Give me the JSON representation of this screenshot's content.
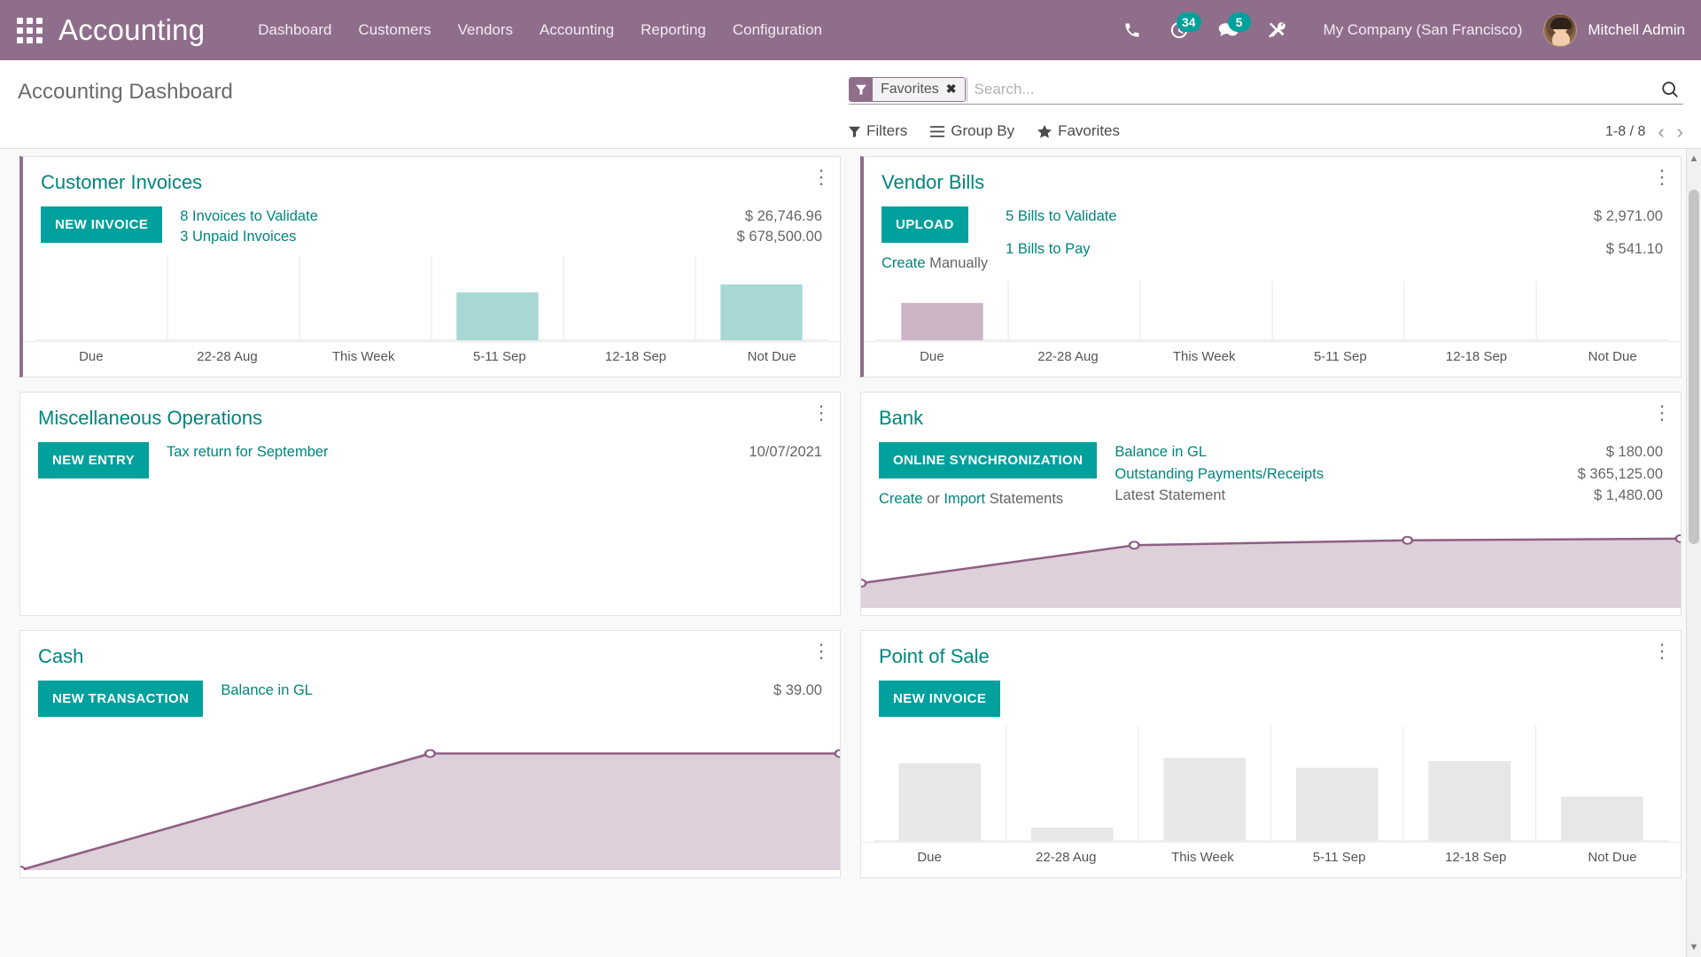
{
  "navbar": {
    "apps_icon": "apps-grid-icon",
    "brand": "Accounting",
    "menu": [
      {
        "label": "Dashboard"
      },
      {
        "label": "Customers"
      },
      {
        "label": "Vendors"
      },
      {
        "label": "Accounting"
      },
      {
        "label": "Reporting"
      },
      {
        "label": "Configuration"
      }
    ],
    "tray": {
      "phone_icon": "phone-icon",
      "activity_icon": "clock-activity-icon",
      "activity_count": "34",
      "messages_icon": "chat-bubble-icon",
      "messages_count": "5",
      "debug_icon": "tools-wrench-icon"
    },
    "company": "My Company (San Francisco)",
    "user": "Mitchell Admin",
    "avatar_icon": "user-avatar"
  },
  "control_panel": {
    "title": "Accounting Dashboard",
    "facet": {
      "icon": "filter-funnel-icon",
      "label": "Favorites",
      "remove": "✖"
    },
    "search": {
      "value": "",
      "placeholder": "Search..."
    },
    "search_icon": "search-magnifier-icon",
    "buttons": [
      {
        "label": "Filters",
        "icon": "filter-funnel-icon"
      },
      {
        "label": "Group By",
        "icon": "hamburger-lines-icon"
      },
      {
        "label": "Favorites",
        "icon": "star-icon"
      }
    ],
    "pager": {
      "range": "1-8 / 8",
      "prev": "‹",
      "next": "›"
    }
  },
  "accent": {
    "brand_purple": "#8f6e8b",
    "teal": "#00a09d",
    "teal_text": "#00857d",
    "bar_teal": "#a8d8d4",
    "bar_purple": "#cbb4c6",
    "bar_gray": "#e7e7e7",
    "line_purple": "#8f5f85",
    "area_purple": "#ddd0da"
  },
  "cards": [
    {
      "id": "customer-invoices",
      "title": "Customer Invoices",
      "button": "NEW INVOICE",
      "sub_links": [],
      "kpis": [
        {
          "label": "8 Invoices to Validate",
          "value": "$ 26,746.96",
          "link": true
        },
        {
          "label": "3 Unpaid Invoices",
          "value": "$ 678,500.00",
          "link": true
        }
      ],
      "chart_data": {
        "type": "bar",
        "title": "Customer Invoices",
        "categories": [
          "Due",
          "22-28 Aug",
          "This Week",
          "5-11 Sep",
          "12-18 Sep",
          "Not Due"
        ],
        "values": [
          0,
          0,
          0,
          60,
          0,
          70
        ],
        "ylim": [
          0,
          100
        ],
        "color": "#a8d8d4",
        "xlabel": "",
        "ylabel": "",
        "grid": true,
        "legend": "none"
      }
    },
    {
      "id": "vendor-bills",
      "title": "Vendor Bills",
      "button": "UPLOAD",
      "sub_links": [
        {
          "text": "Create",
          "link": true
        },
        {
          "text": " Manually",
          "link": false
        }
      ],
      "kpis": [
        {
          "label": "5 Bills to Validate",
          "value": "$ 2,971.00",
          "link": true
        },
        {
          "label": "1 Bills to Pay",
          "value": "$ 541.10",
          "link": true
        }
      ],
      "chart_data": {
        "type": "bar",
        "title": "Vendor Bills",
        "categories": [
          "Due",
          "22-28 Aug",
          "This Week",
          "5-11 Sep",
          "12-18 Sep",
          "Not Due"
        ],
        "values": [
          68,
          0,
          0,
          0,
          0,
          0
        ],
        "ylim": [
          0,
          100
        ],
        "color": "#cbb4c6",
        "xlabel": "",
        "ylabel": "",
        "grid": true,
        "legend": "none"
      }
    },
    {
      "id": "miscellaneous-operations",
      "title": "Miscellaneous Operations",
      "button": "NEW ENTRY",
      "sub_links": [],
      "kpis": [
        {
          "label": "Tax return for September",
          "value": "10/07/2021",
          "link": true
        }
      ],
      "chart_data": null
    },
    {
      "id": "bank",
      "title": "Bank",
      "button": "ONLINE SYNCHRONIZATION",
      "sub_links": [
        {
          "text": "Create",
          "link": true
        },
        {
          "text": " or ",
          "link": false
        },
        {
          "text": "Import",
          "link": true
        },
        {
          "text": " Statements",
          "link": false
        }
      ],
      "kpis": [
        {
          "label": "Balance in GL",
          "value": "$ 180.00",
          "link": true
        },
        {
          "label": "Outstanding Payments/Receipts",
          "value": "$ 365,125.00",
          "link": true
        },
        {
          "label": "Latest Statement",
          "value": "$ 1,480.00",
          "link": false
        }
      ],
      "chart_data": {
        "type": "area",
        "title": "Bank",
        "x": [
          0,
          1,
          2,
          3
        ],
        "values": [
          30,
          76,
          82,
          84
        ],
        "ylim": [
          0,
          100
        ],
        "line_color": "#8f5f85",
        "fill_color": "#ddd0da",
        "markers": true,
        "grid": false
      }
    },
    {
      "id": "cash",
      "title": "Cash",
      "button": "NEW TRANSACTION",
      "sub_links": [],
      "kpis": [
        {
          "label": "Balance in GL",
          "value": "$ 39.00",
          "link": true
        }
      ],
      "chart_data": {
        "type": "area",
        "title": "Cash",
        "x": [
          0,
          1,
          2
        ],
        "values": [
          0,
          86,
          86
        ],
        "ylim": [
          0,
          100
        ],
        "line_color": "#8f5f85",
        "fill_color": "#ddd0da",
        "markers": true,
        "grid": false
      }
    },
    {
      "id": "point-of-sale",
      "title": "Point of Sale",
      "button": "NEW INVOICE",
      "sub_links": [],
      "kpis": [],
      "chart_data": {
        "type": "bar",
        "title": "Point of Sale",
        "categories": [
          "Due",
          "22-28 Aug",
          "This Week",
          "5-11 Sep",
          "12-18 Sep",
          "Not Due"
        ],
        "values": [
          70,
          12,
          75,
          66,
          72,
          40
        ],
        "ylim": [
          0,
          100
        ],
        "color": "#e7e7e7",
        "xlabel": "",
        "ylabel": "",
        "grid": true,
        "legend": "none"
      }
    }
  ]
}
